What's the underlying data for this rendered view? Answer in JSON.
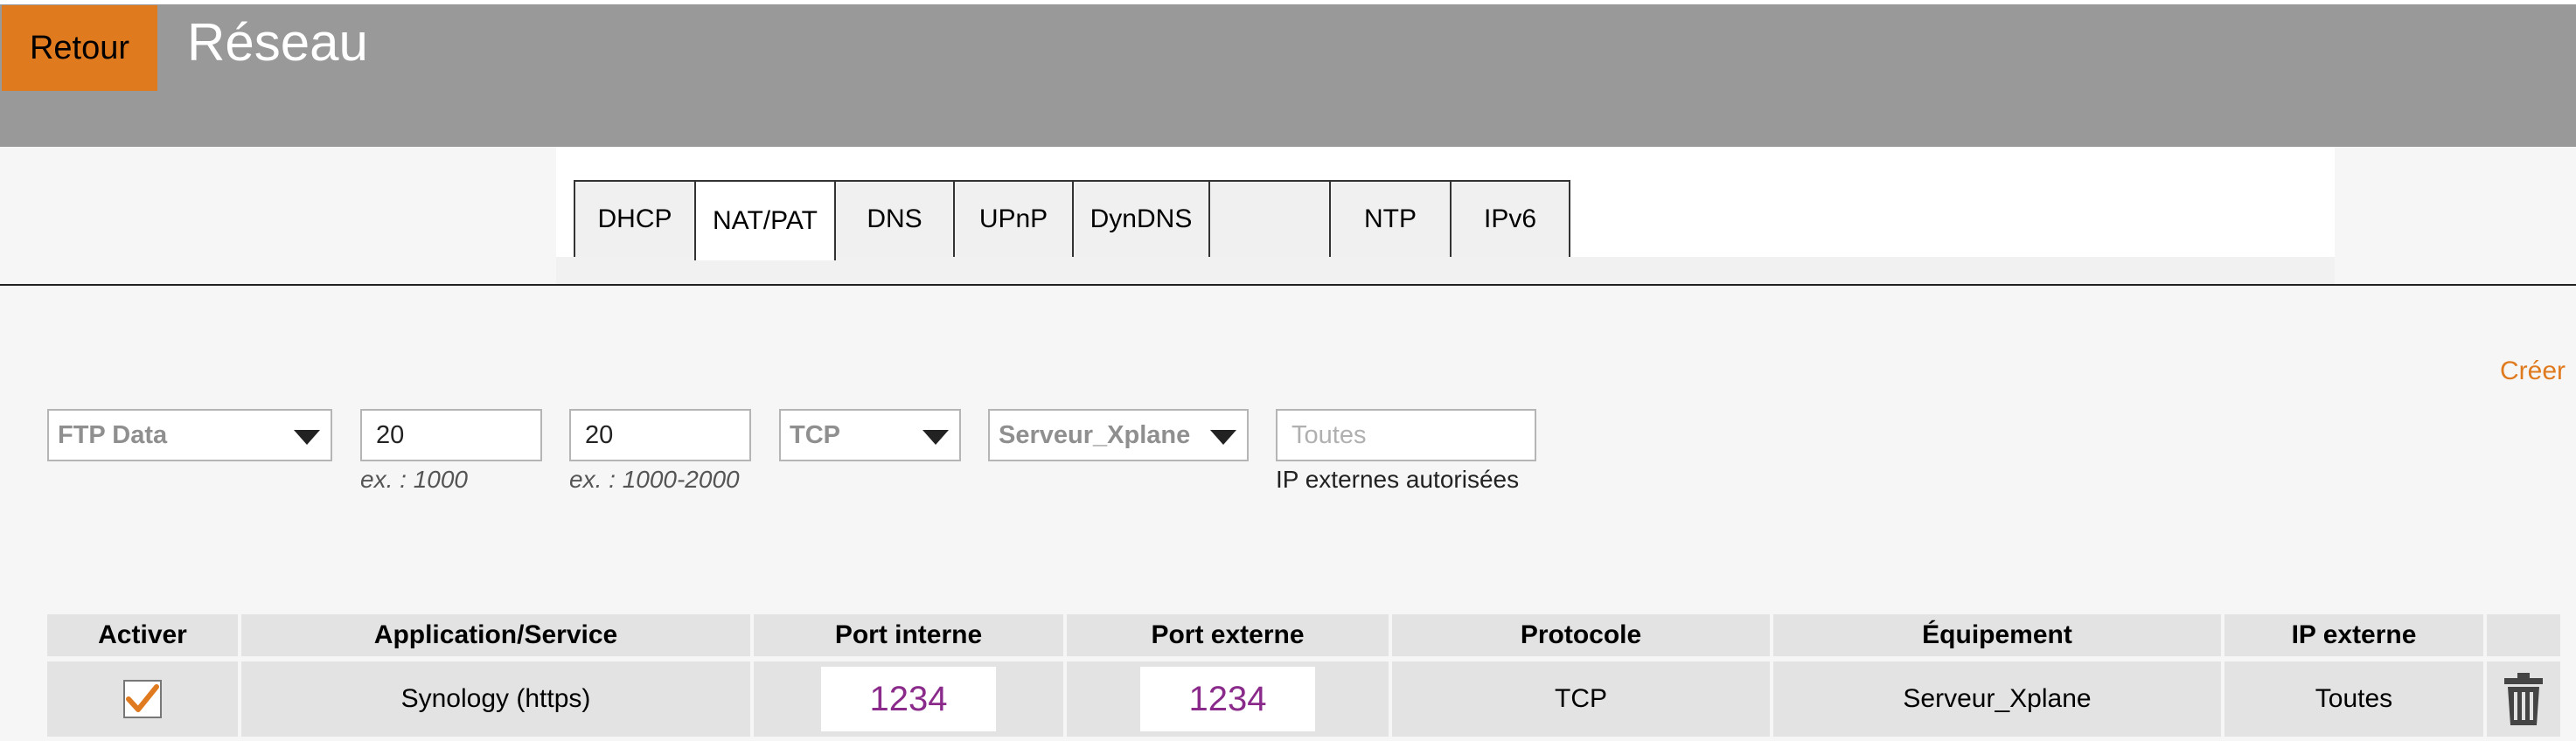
{
  "header": {
    "back_label": "Retour",
    "title": "Réseau"
  },
  "tabs": [
    {
      "label": "DHCP"
    },
    {
      "label": "NAT/PAT",
      "active": true
    },
    {
      "label": "DNS"
    },
    {
      "label": "UPnP"
    },
    {
      "label": "DynDNS"
    },
    {
      "label": ""
    },
    {
      "label": "NTP"
    },
    {
      "label": "IPv6"
    }
  ],
  "create_label": "Créer",
  "form": {
    "application_select": "FTP Data",
    "internal_port": "20",
    "internal_port_hint": "ex. : 1000",
    "external_port": "20",
    "external_port_hint": "ex. : 1000-2000",
    "protocol_select": "TCP",
    "device_select": "Serveur_Xplane",
    "external_ip_placeholder": "Toutes",
    "external_ip_hint": "IP externes autorisées"
  },
  "table": {
    "headers": [
      "Activer",
      "Application/Service",
      "Port interne",
      "Port externe",
      "Protocole",
      "Équipement",
      "IP externe"
    ],
    "rows": [
      {
        "enabled": true,
        "application": "Synology (https)",
        "internal_port": "1234",
        "external_port": "1234",
        "protocol": "TCP",
        "device": "Serveur_Xplane",
        "external_ip": "Toutes"
      }
    ]
  },
  "colors": {
    "accent": "#e07a1f",
    "header_bg": "#999999",
    "port_text": "#8a2a8a"
  }
}
